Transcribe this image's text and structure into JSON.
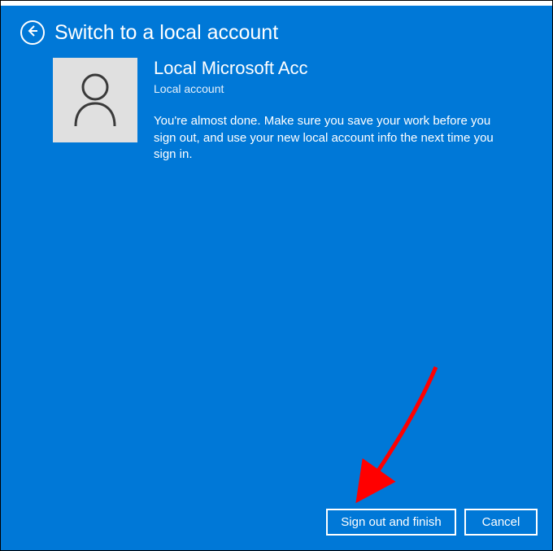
{
  "header": {
    "title": "Switch to a local account"
  },
  "account": {
    "name": "Local Microsoft Acc",
    "type": "Local account",
    "description": "You're almost done. Make sure you save your work before you sign out, and use your new local account info the next time you sign in."
  },
  "footer": {
    "primary": "Sign out and finish",
    "cancel": "Cancel"
  }
}
